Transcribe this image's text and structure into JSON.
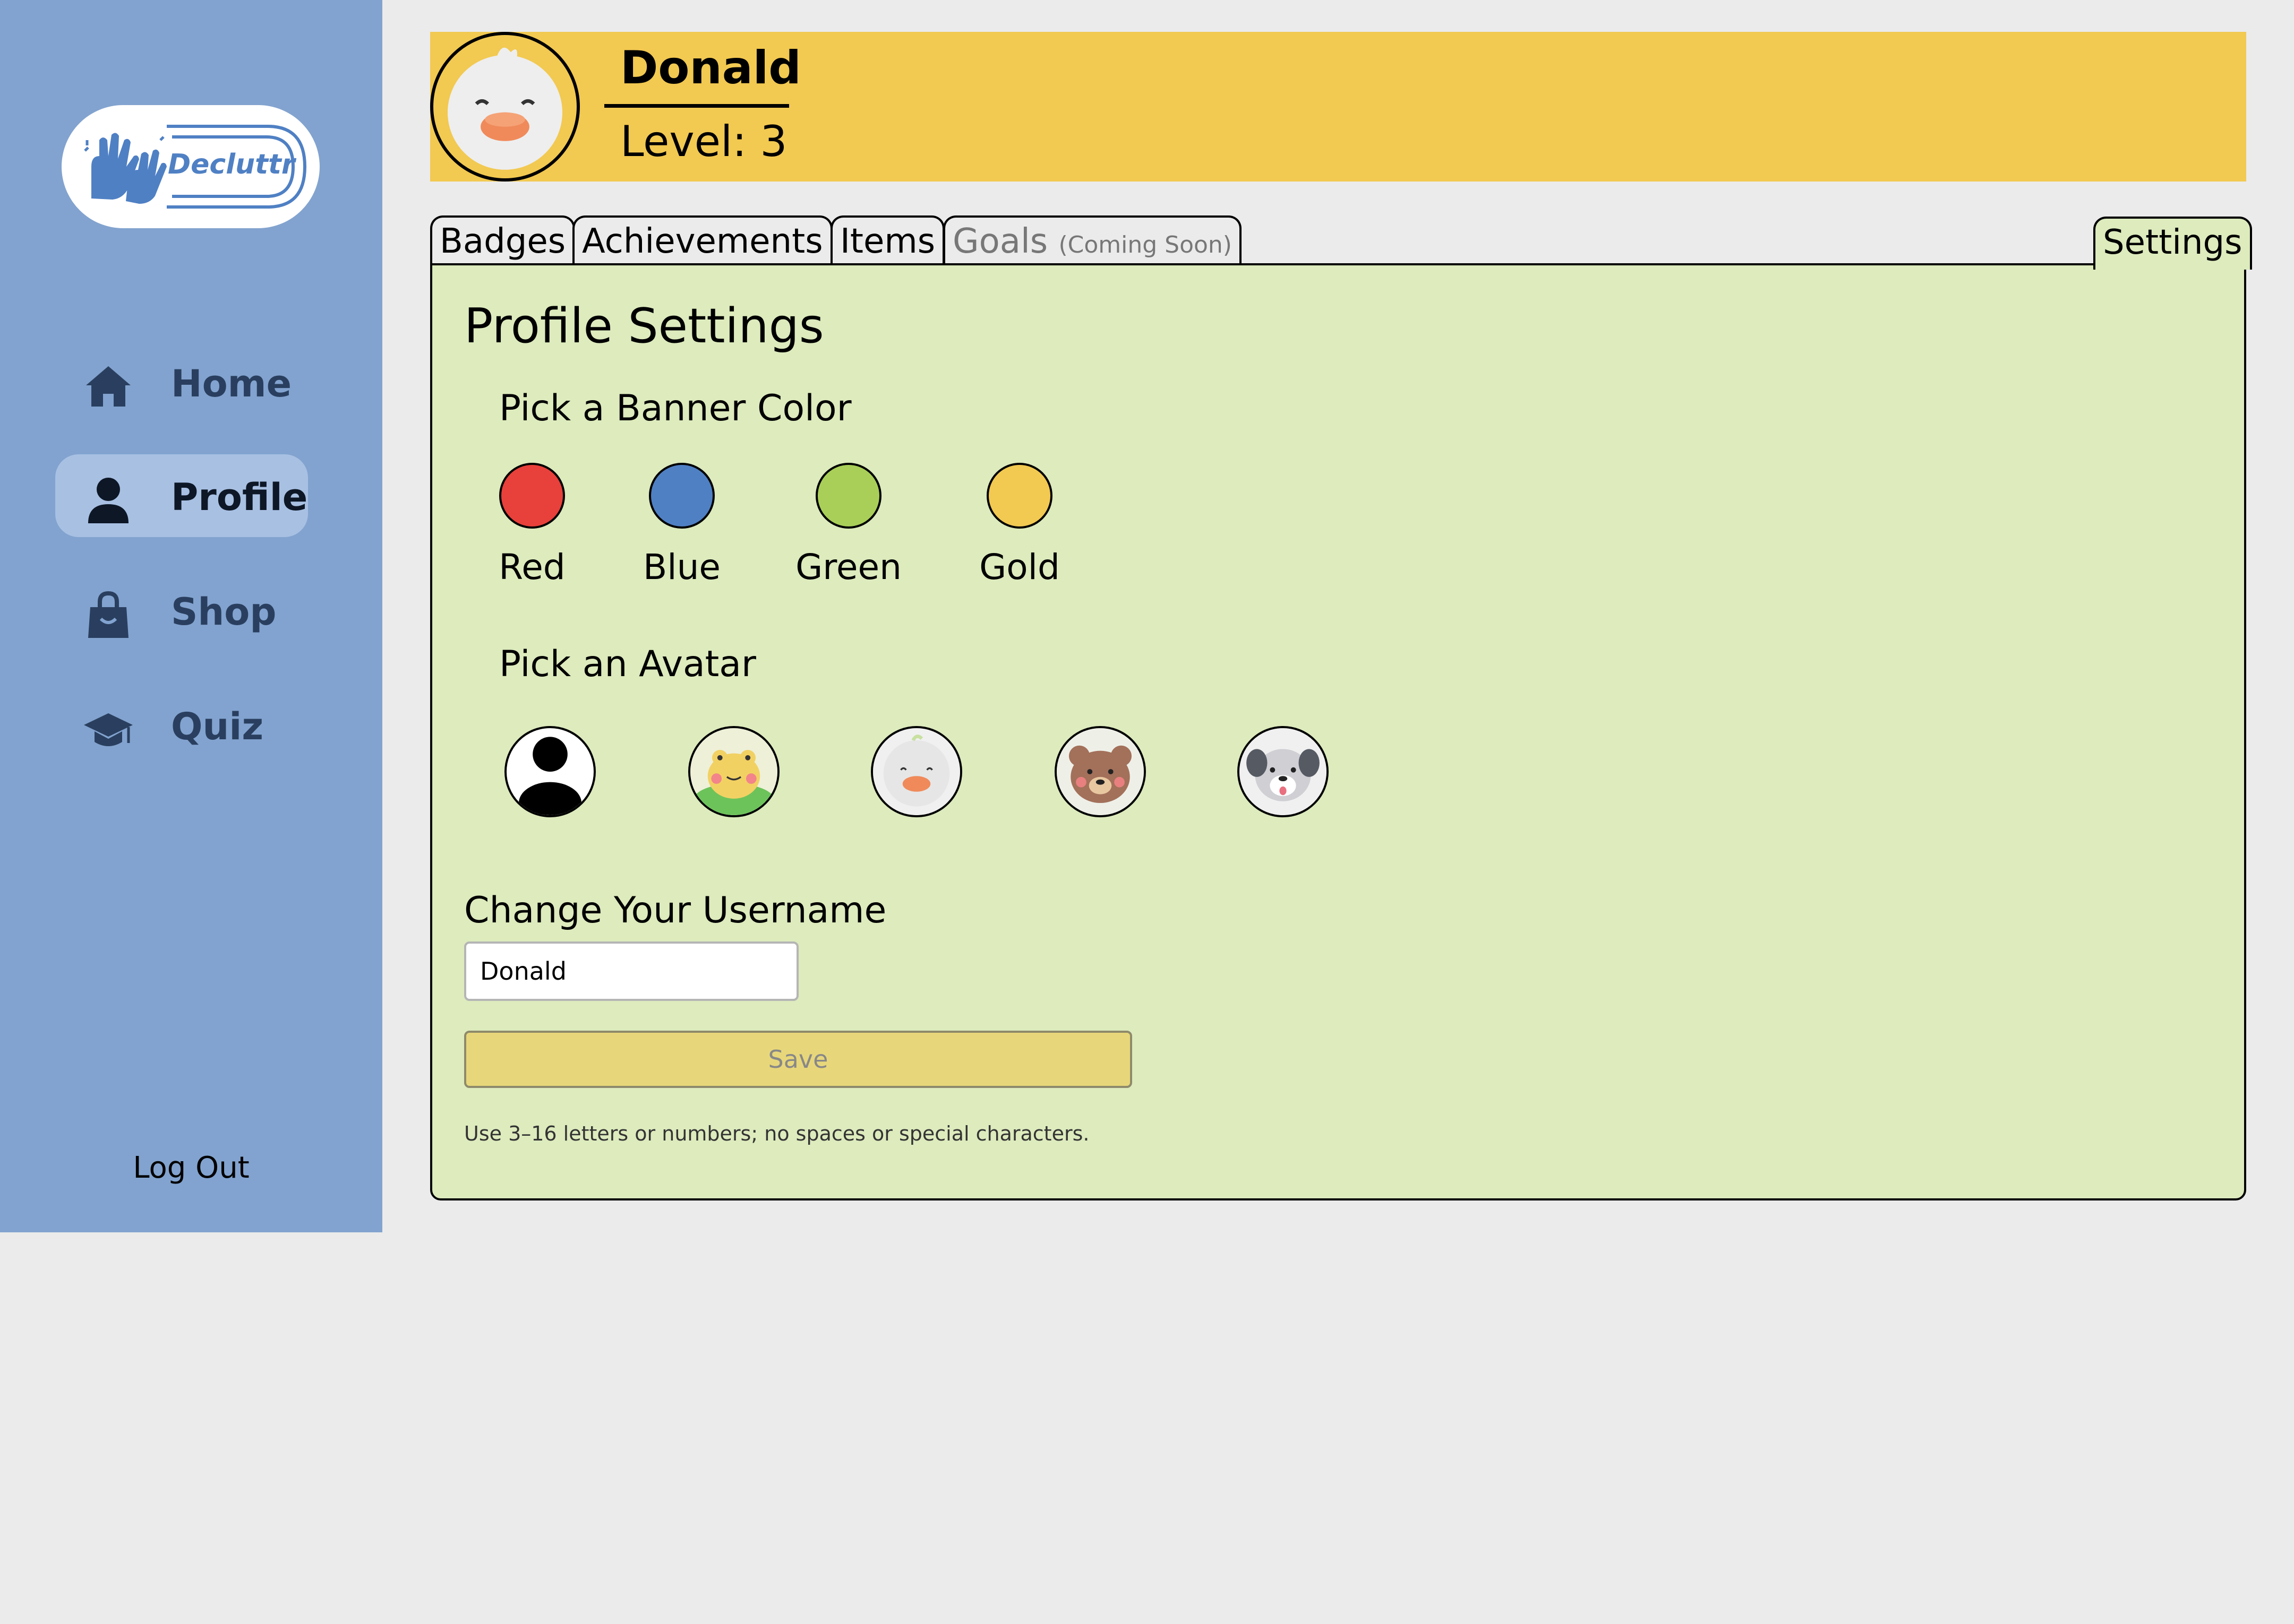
{
  "sidebar": {
    "logo_text": "Decluttr",
    "nav": [
      {
        "label": "Home",
        "icon": "home-icon"
      },
      {
        "label": "Profile",
        "icon": "user-icon",
        "active": true
      },
      {
        "label": "Shop",
        "icon": "shopping-bag-icon"
      },
      {
        "label": "Quiz",
        "icon": "graduation-cap-icon"
      }
    ],
    "logout_label": "Log Out"
  },
  "header": {
    "name": "Donald",
    "level": "Level: 3",
    "banner_color": "#f2c951",
    "avatar": "duck-avatar"
  },
  "tabs": {
    "badges": "Badges",
    "achievements": "Achievements",
    "items": "Items",
    "goals": "Goals",
    "goals_note": "(Coming Soon)",
    "settings": "Settings",
    "active": "Settings"
  },
  "settings": {
    "title": "Profile Settings",
    "banner_heading": "Pick a Banner Color",
    "colors": [
      {
        "label": "Red",
        "hex": "#e8403a"
      },
      {
        "label": "Blue",
        "hex": "#4f80c4"
      },
      {
        "label": "Green",
        "hex": "#a9cf58"
      },
      {
        "label": "Gold",
        "hex": "#f2c951"
      }
    ],
    "avatar_heading": "Pick an Avatar",
    "avatars": [
      "default-person-avatar",
      "frog-avatar",
      "duck-avatar",
      "bear-avatar",
      "dog-avatar"
    ],
    "username_heading": "Change Your Username",
    "username_value": "Donald",
    "save_label": "Save",
    "hint": "Use 3–16 letters or numbers; no spaces or special characters."
  }
}
